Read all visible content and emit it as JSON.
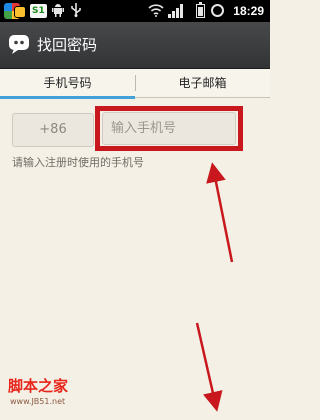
{
  "status_bar": {
    "sim_label": "S1",
    "time": "18:29",
    "icons": [
      "app-icon",
      "sim-icon",
      "android-icon",
      "usb-icon",
      "wifi-icon",
      "signal-icon",
      "battery-icon",
      "alarm-icon"
    ]
  },
  "title_bar": {
    "title": "找回密码",
    "icon": "chat-bubble-icon"
  },
  "tabs": [
    {
      "label": "手机号码",
      "active": true
    },
    {
      "label": "电子邮箱",
      "active": false
    }
  ],
  "form": {
    "country_code": "+86",
    "phone_placeholder": "输入手机号",
    "phone_value": "",
    "hint": "请输入注册时使用的手机号"
  },
  "annotation": {
    "highlight_color": "#c8181e",
    "arrow_color": "#c8181e"
  },
  "watermark": {
    "title": "脚本之家",
    "url": "www.JB51.net"
  },
  "colors": {
    "accent": "#43a1d9",
    "background": "#f4f0e6",
    "title_bar": "#3d3e40"
  }
}
